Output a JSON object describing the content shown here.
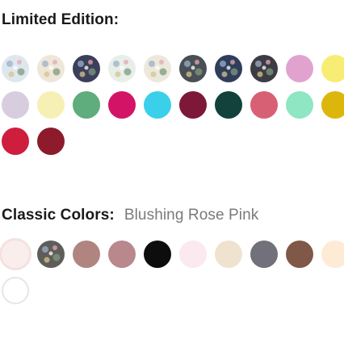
{
  "limited": {
    "title": "Limited Edition:",
    "swatches": [
      {
        "name": "floral-white-blue",
        "color": "#dfe7ee",
        "pattern": true
      },
      {
        "name": "floral-cream-pink",
        "color": "#efe6da",
        "pattern": true
      },
      {
        "name": "floral-navy",
        "color": "#3c3f5a",
        "pattern": true
      },
      {
        "name": "floral-green-white",
        "color": "#e7efe8",
        "pattern": true
      },
      {
        "name": "speckle-cream",
        "color": "#ece8dc",
        "pattern": true
      },
      {
        "name": "charcoal-lace",
        "color": "#4a4f56",
        "pattern": true
      },
      {
        "name": "navy-pattern",
        "color": "#2f3e5a",
        "pattern": true
      },
      {
        "name": "floral-dark",
        "color": "#3c3c44",
        "pattern": true
      },
      {
        "name": "lavender-pink",
        "color": "#e2a2cf"
      },
      {
        "name": "pastel-yellow",
        "color": "#f7ed74"
      },
      {
        "name": "light-lavender",
        "color": "#d8cddf"
      },
      {
        "name": "cream-yellow",
        "color": "#f6f0b4"
      },
      {
        "name": "green",
        "color": "#5fac7c"
      },
      {
        "name": "cerise",
        "color": "#d31466"
      },
      {
        "name": "sky-blue",
        "color": "#3ad0ea"
      },
      {
        "name": "wine",
        "color": "#7d1838"
      },
      {
        "name": "dark-teal",
        "color": "#12423b"
      },
      {
        "name": "coral-rose",
        "color": "#d86074"
      },
      {
        "name": "mint",
        "color": "#8ee6c3"
      },
      {
        "name": "mustard",
        "color": "#ddb60c"
      },
      {
        "name": "crimson",
        "color": "#cf1d3d"
      },
      {
        "name": "burgundy",
        "color": "#8d1b2c"
      }
    ]
  },
  "classic": {
    "label": "Classic Colors:",
    "selected_name": "Blushing Rose Pink",
    "swatches": [
      {
        "name": "blushing-rose-pink",
        "color": "#f9eeec",
        "selected": true
      },
      {
        "name": "floral-grey",
        "color": "#5f5d5a",
        "pattern": true
      },
      {
        "name": "mauve-taupe",
        "color": "#b08580"
      },
      {
        "name": "dusty-rose",
        "color": "#b8888c"
      },
      {
        "name": "black",
        "color": "#0d0d0d"
      },
      {
        "name": "pale-pink",
        "color": "#fae9ef"
      },
      {
        "name": "sand",
        "color": "#efe3cf"
      },
      {
        "name": "slate-grey",
        "color": "#72707b"
      },
      {
        "name": "brown",
        "color": "#7f5847"
      },
      {
        "name": "peach-cream",
        "color": "#fdebd6"
      },
      {
        "name": "white",
        "color": "#ffffff",
        "outline": true
      }
    ]
  }
}
